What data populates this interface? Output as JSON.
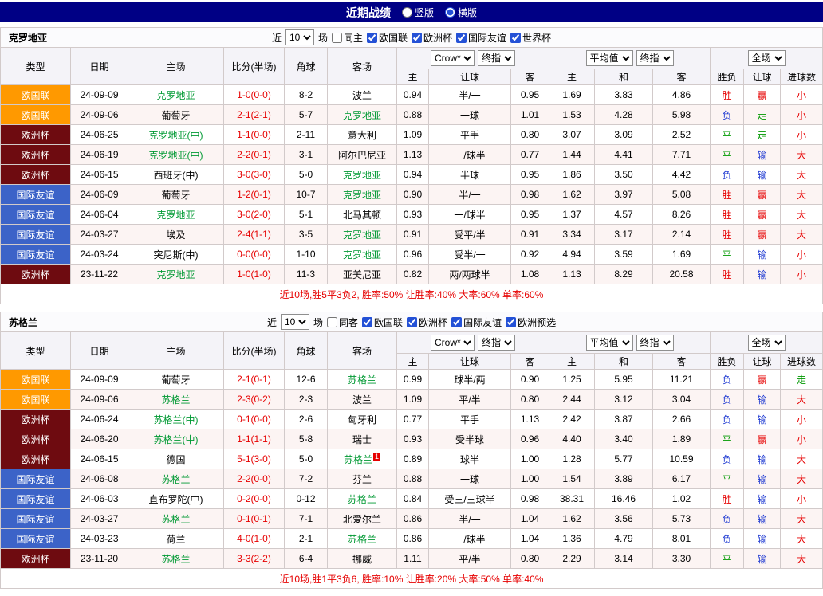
{
  "page": {
    "title": "近期战绩",
    "view_options": [
      {
        "label": "竖版",
        "selected": false
      },
      {
        "label": "横版",
        "selected": true
      }
    ]
  },
  "colors": {
    "header_bar": "#000085",
    "focal_team": "#009933",
    "score": "#e60000",
    "summary": "#e60000",
    "type": {
      "欧国联": "#ff9900",
      "欧洲杯": "#6e0b10",
      "国际友谊": "#3c63c8"
    },
    "result": {
      "胜": "#e60000",
      "负": "#1f3ad2",
      "平": "#009900",
      "赢": "#e60000",
      "输": "#1f3ad2",
      "走": "#009900",
      "大": "#e60000",
      "小": "#e60000"
    }
  },
  "tables": [
    {
      "team": "克罗地亚",
      "filter": {
        "near": "近",
        "count": "10",
        "games": "场",
        "same_label": "同主",
        "same_checked": false,
        "leagues": [
          {
            "label": "欧国联",
            "checked": true
          },
          {
            "label": "欧洲杯",
            "checked": true
          },
          {
            "label": "国际友谊",
            "checked": true
          },
          {
            "label": "世界杯",
            "checked": true
          }
        ]
      },
      "selects": {
        "bookmaker": "Crow*",
        "final_asia": "终指",
        "average": "平均值",
        "final_eu": "终指",
        "scope": "全场"
      },
      "headers": [
        "类型",
        "日期",
        "主场",
        "比分(半场)",
        "角球",
        "客场",
        "主",
        "让球",
        "客",
        "主",
        "和",
        "客",
        "胜负",
        "让球",
        "进球数"
      ],
      "rows": [
        {
          "type": "欧国联",
          "date": "24-09-09",
          "home": "克罗地亚",
          "home_focal": true,
          "score": "1-0(0-0)",
          "corners": "8-2",
          "away": "波兰",
          "away_focal": false,
          "asia": [
            "0.94",
            "半/一",
            "0.95"
          ],
          "europe": [
            "1.69",
            "3.83",
            "4.86"
          ],
          "result": "胜",
          "handicap_result": "赢",
          "goals": "小"
        },
        {
          "type": "欧国联",
          "date": "24-09-06",
          "home": "葡萄牙",
          "home_focal": false,
          "score": "2-1(2-1)",
          "corners": "5-7",
          "away": "克罗地亚",
          "away_focal": true,
          "asia": [
            "0.88",
            "一球",
            "1.01"
          ],
          "europe": [
            "1.53",
            "4.28",
            "5.98"
          ],
          "result": "负",
          "handicap_result": "走",
          "goals": "小"
        },
        {
          "type": "欧洲杯",
          "date": "24-06-25",
          "home": "克罗地亚(中)",
          "home_focal": true,
          "score": "1-1(0-0)",
          "corners": "2-11",
          "away": "意大利",
          "away_focal": false,
          "asia": [
            "1.09",
            "平手",
            "0.80"
          ],
          "europe": [
            "3.07",
            "3.09",
            "2.52"
          ],
          "result": "平",
          "handicap_result": "走",
          "goals": "小"
        },
        {
          "type": "欧洲杯",
          "date": "24-06-19",
          "home": "克罗地亚(中)",
          "home_focal": true,
          "score": "2-2(0-1)",
          "corners": "3-1",
          "away": "阿尔巴尼亚",
          "away_focal": false,
          "asia": [
            "1.13",
            "一/球半",
            "0.77"
          ],
          "europe": [
            "1.44",
            "4.41",
            "7.71"
          ],
          "result": "平",
          "handicap_result": "输",
          "goals": "大"
        },
        {
          "type": "欧洲杯",
          "date": "24-06-15",
          "home": "西班牙(中)",
          "home_focal": false,
          "score": "3-0(3-0)",
          "corners": "5-0",
          "away": "克罗地亚",
          "away_focal": true,
          "asia": [
            "0.94",
            "半球",
            "0.95"
          ],
          "europe": [
            "1.86",
            "3.50",
            "4.42"
          ],
          "result": "负",
          "handicap_result": "输",
          "goals": "大"
        },
        {
          "type": "国际友谊",
          "date": "24-06-09",
          "home": "葡萄牙",
          "home_focal": false,
          "score": "1-2(0-1)",
          "corners": "10-7",
          "away": "克罗地亚",
          "away_focal": true,
          "asia": [
            "0.90",
            "半/一",
            "0.98"
          ],
          "europe": [
            "1.62",
            "3.97",
            "5.08"
          ],
          "result": "胜",
          "handicap_result": "赢",
          "goals": "大"
        },
        {
          "type": "国际友谊",
          "date": "24-06-04",
          "home": "克罗地亚",
          "home_focal": true,
          "score": "3-0(2-0)",
          "corners": "5-1",
          "away": "北马其顿",
          "away_focal": false,
          "asia": [
            "0.93",
            "一/球半",
            "0.95"
          ],
          "europe": [
            "1.37",
            "4.57",
            "8.26"
          ],
          "result": "胜",
          "handicap_result": "赢",
          "goals": "大"
        },
        {
          "type": "国际友谊",
          "date": "24-03-27",
          "home": "埃及",
          "home_focal": false,
          "score": "2-4(1-1)",
          "corners": "3-5",
          "away": "克罗地亚",
          "away_focal": true,
          "asia": [
            "0.91",
            "受平/半",
            "0.91"
          ],
          "europe": [
            "3.34",
            "3.17",
            "2.14"
          ],
          "result": "胜",
          "handicap_result": "赢",
          "goals": "大"
        },
        {
          "type": "国际友谊",
          "date": "24-03-24",
          "home": "突尼斯(中)",
          "home_focal": false,
          "score": "0-0(0-0)",
          "corners": "1-10",
          "away": "克罗地亚",
          "away_focal": true,
          "asia": [
            "0.96",
            "受半/一",
            "0.92"
          ],
          "europe": [
            "4.94",
            "3.59",
            "1.69"
          ],
          "result": "平",
          "handicap_result": "输",
          "goals": "小"
        },
        {
          "type": "欧洲杯",
          "date": "23-11-22",
          "home": "克罗地亚",
          "home_focal": true,
          "score": "1-0(1-0)",
          "corners": "11-3",
          "away": "亚美尼亚",
          "away_focal": false,
          "asia": [
            "0.82",
            "两/两球半",
            "1.08"
          ],
          "europe": [
            "1.13",
            "8.29",
            "20.58"
          ],
          "result": "胜",
          "handicap_result": "输",
          "goals": "小"
        }
      ],
      "summary": "近10场,胜5平3负2, 胜率:50% 让胜率:40% 大率:60% 单率:60%"
    },
    {
      "team": "苏格兰",
      "filter": {
        "near": "近",
        "count": "10",
        "games": "场",
        "same_label": "同客",
        "same_checked": false,
        "leagues": [
          {
            "label": "欧国联",
            "checked": true
          },
          {
            "label": "欧洲杯",
            "checked": true
          },
          {
            "label": "国际友谊",
            "checked": true
          },
          {
            "label": "欧洲预选",
            "checked": true
          }
        ]
      },
      "selects": {
        "bookmaker": "Crow*",
        "final_asia": "终指",
        "average": "平均值",
        "final_eu": "终指",
        "scope": "全场"
      },
      "headers": [
        "类型",
        "日期",
        "主场",
        "比分(半场)",
        "角球",
        "客场",
        "主",
        "让球",
        "客",
        "主",
        "和",
        "客",
        "胜负",
        "让球",
        "进球数"
      ],
      "rows": [
        {
          "type": "欧国联",
          "date": "24-09-09",
          "home": "葡萄牙",
          "home_focal": false,
          "score": "2-1(0-1)",
          "corners": "12-6",
          "away": "苏格兰",
          "away_focal": true,
          "asia": [
            "0.99",
            "球半/两",
            "0.90"
          ],
          "europe": [
            "1.25",
            "5.95",
            "11.21"
          ],
          "result": "负",
          "handicap_result": "赢",
          "goals": "走"
        },
        {
          "type": "欧国联",
          "date": "24-09-06",
          "home": "苏格兰",
          "home_focal": true,
          "score": "2-3(0-2)",
          "corners": "2-3",
          "away": "波兰",
          "away_focal": false,
          "asia": [
            "1.09",
            "平/半",
            "0.80"
          ],
          "europe": [
            "2.44",
            "3.12",
            "3.04"
          ],
          "result": "负",
          "handicap_result": "输",
          "goals": "大"
        },
        {
          "type": "欧洲杯",
          "date": "24-06-24",
          "home": "苏格兰(中)",
          "home_focal": true,
          "score": "0-1(0-0)",
          "corners": "2-6",
          "away": "匈牙利",
          "away_focal": false,
          "asia": [
            "0.77",
            "平手",
            "1.13"
          ],
          "europe": [
            "2.42",
            "3.87",
            "2.66"
          ],
          "result": "负",
          "handicap_result": "输",
          "goals": "小"
        },
        {
          "type": "欧洲杯",
          "date": "24-06-20",
          "home": "苏格兰(中)",
          "home_focal": true,
          "score": "1-1(1-1)",
          "corners": "5-8",
          "away": "瑞士",
          "away_focal": false,
          "asia": [
            "0.93",
            "受半球",
            "0.96"
          ],
          "europe": [
            "4.40",
            "3.40",
            "1.89"
          ],
          "result": "平",
          "handicap_result": "赢",
          "goals": "小"
        },
        {
          "type": "欧洲杯",
          "date": "24-06-15",
          "home": "德国",
          "home_focal": false,
          "score": "5-1(3-0)",
          "corners": "5-0",
          "away": "苏格兰",
          "away_focal": true,
          "away_badge": "1",
          "asia": [
            "0.89",
            "球半",
            "1.00"
          ],
          "europe": [
            "1.28",
            "5.77",
            "10.59"
          ],
          "result": "负",
          "handicap_result": "输",
          "goals": "大"
        },
        {
          "type": "国际友谊",
          "date": "24-06-08",
          "home": "苏格兰",
          "home_focal": true,
          "score": "2-2(0-0)",
          "corners": "7-2",
          "away": "芬兰",
          "away_focal": false,
          "asia": [
            "0.88",
            "一球",
            "1.00"
          ],
          "europe": [
            "1.54",
            "3.89",
            "6.17"
          ],
          "result": "平",
          "handicap_result": "输",
          "goals": "大"
        },
        {
          "type": "国际友谊",
          "date": "24-06-03",
          "home": "直布罗陀(中)",
          "home_focal": false,
          "score": "0-2(0-0)",
          "corners": "0-12",
          "away": "苏格兰",
          "away_focal": true,
          "asia": [
            "0.84",
            "受三/三球半",
            "0.98"
          ],
          "europe": [
            "38.31",
            "16.46",
            "1.02"
          ],
          "result": "胜",
          "handicap_result": "输",
          "goals": "小"
        },
        {
          "type": "国际友谊",
          "date": "24-03-27",
          "home": "苏格兰",
          "home_focal": true,
          "score": "0-1(0-1)",
          "corners": "7-1",
          "away": "北爱尔兰",
          "away_focal": false,
          "asia": [
            "0.86",
            "半/一",
            "1.04"
          ],
          "europe": [
            "1.62",
            "3.56",
            "5.73"
          ],
          "result": "负",
          "handicap_result": "输",
          "goals": "大"
        },
        {
          "type": "国际友谊",
          "date": "24-03-23",
          "home": "荷兰",
          "home_focal": false,
          "score": "4-0(1-0)",
          "corners": "2-1",
          "away": "苏格兰",
          "away_focal": true,
          "asia": [
            "0.86",
            "一/球半",
            "1.04"
          ],
          "europe": [
            "1.36",
            "4.79",
            "8.01"
          ],
          "result": "负",
          "handicap_result": "输",
          "goals": "大"
        },
        {
          "type": "欧洲杯",
          "date": "23-11-20",
          "home": "苏格兰",
          "home_focal": true,
          "score": "3-3(2-2)",
          "corners": "6-4",
          "away": "挪威",
          "away_focal": false,
          "asia": [
            "1.11",
            "平/半",
            "0.80"
          ],
          "europe": [
            "2.29",
            "3.14",
            "3.30"
          ],
          "result": "平",
          "handicap_result": "输",
          "goals": "大"
        }
      ],
      "summary": "近10场,胜1平3负6, 胜率:10% 让胜率:20% 大率:50% 单率:40%"
    }
  ]
}
